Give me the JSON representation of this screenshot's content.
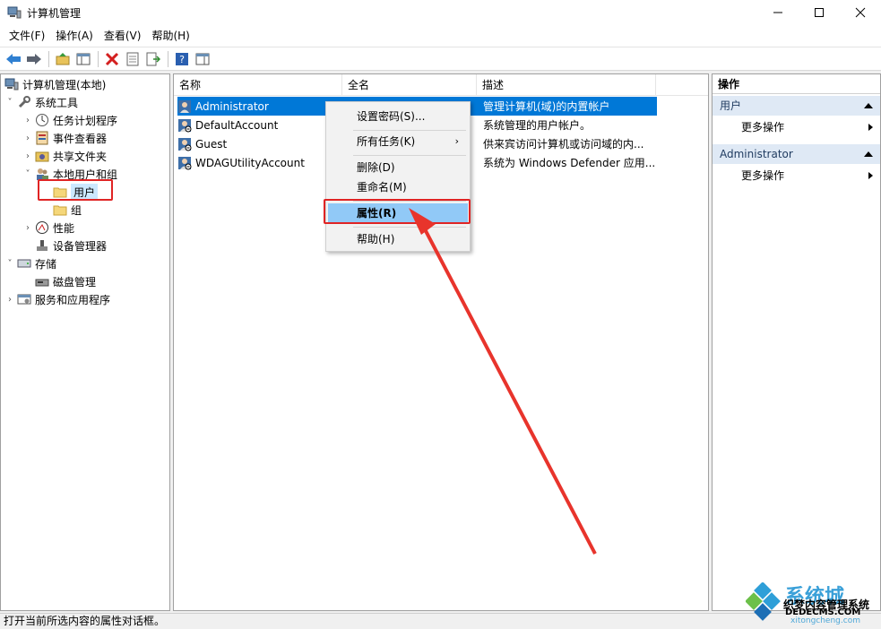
{
  "window": {
    "title": "计算机管理",
    "minimize_icon": "minimize-icon",
    "maximize_icon": "maximize-icon",
    "close_icon": "close-icon"
  },
  "menu": [
    "文件(F)",
    "操作(A)",
    "查看(V)",
    "帮助(H)"
  ],
  "tree": [
    {
      "label": "计算机管理(本地)",
      "icon": "computer-management-icon",
      "expander": ""
    },
    {
      "label": "系统工具",
      "icon": "system-tools-icon",
      "expander": "expanded"
    },
    {
      "label": "任务计划程序",
      "icon": "task-scheduler-icon",
      "expander": "collapsed"
    },
    {
      "label": "事件查看器",
      "icon": "event-viewer-icon",
      "expander": "collapsed"
    },
    {
      "label": "共享文件夹",
      "icon": "shared-folders-icon",
      "expander": "collapsed"
    },
    {
      "label": "本地用户和组",
      "icon": "local-users-groups-icon",
      "expander": "expanded"
    },
    {
      "label": "用户",
      "icon": "folder-icon",
      "expander": "",
      "selected": true
    },
    {
      "label": "组",
      "icon": "folder-icon",
      "expander": ""
    },
    {
      "label": "性能",
      "icon": "performance-icon",
      "expander": "collapsed"
    },
    {
      "label": "设备管理器",
      "icon": "device-manager-icon",
      "expander": ""
    },
    {
      "label": "存储",
      "icon": "storage-icon",
      "expander": "expanded"
    },
    {
      "label": "磁盘管理",
      "icon": "disk-management-icon",
      "expander": ""
    },
    {
      "label": "服务和应用程序",
      "icon": "services-apps-icon",
      "expander": "collapsed"
    }
  ],
  "list": {
    "columns": [
      "名称",
      "全名",
      "描述"
    ],
    "rows": [
      {
        "name": "Administrator",
        "desc": "管理计算机(域)的内置帐户",
        "selected": true
      },
      {
        "name": "DefaultAccount",
        "desc": "系统管理的用户帐户。"
      },
      {
        "name": "Guest",
        "desc": "供来宾访问计算机或访问域的内..."
      },
      {
        "name": "WDAGUtilityAccount",
        "desc": "系统为 Windows Defender 应用..."
      }
    ]
  },
  "context_menu": {
    "items": [
      "设置密码(S)...",
      "所有任务(K)",
      "删除(D)",
      "重命名(M)",
      "属性(R)",
      "帮助(H)"
    ],
    "submenu_arrow": "›"
  },
  "actions": {
    "title": "操作",
    "sections": [
      {
        "label": "用户",
        "item": "更多操作"
      },
      {
        "label": "Administrator",
        "item": "更多操作"
      }
    ]
  },
  "status": "打开当前所选内容的属性对话框。",
  "watermark": {
    "title": "系统城",
    "line1": "织梦内容管理系统",
    "line2": "DEDECMS.COM",
    "line3": "xitongcheng.com"
  },
  "colors": {
    "selection": "#0078d7",
    "highlight_menu": "#91c9f7",
    "annotation_red": "#e02424"
  }
}
